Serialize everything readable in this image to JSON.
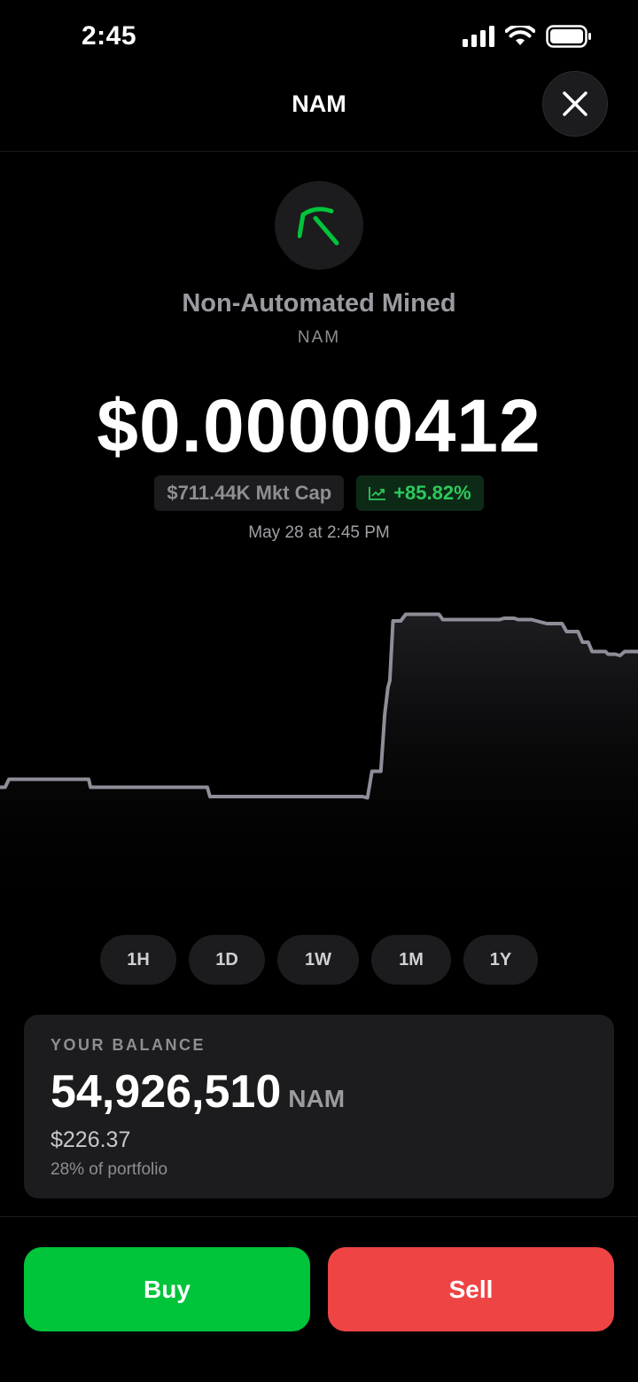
{
  "status_bar": {
    "time": "2:45"
  },
  "header": {
    "title": "NAM",
    "close_icon": "close-icon"
  },
  "token": {
    "icon": "pickaxe-icon",
    "icon_color": "#00c43a",
    "name": "Non-Automated Mined",
    "symbol": "NAM",
    "price": "$0.00000412",
    "market_cap": "$711.44K Mkt Cap",
    "change": "+85.82%",
    "change_icon": "trending-up-icon",
    "timestamp": "May 28 at 2:45 PM"
  },
  "chart_data": {
    "type": "line",
    "ylim": [
      0,
      1
    ],
    "grid": false,
    "line_color": "#8e8e98",
    "points": [
      [
        0,
        0.325
      ],
      [
        0.8,
        0.325
      ],
      [
        1.4,
        0.355
      ],
      [
        2.8,
        0.355
      ],
      [
        13.9,
        0.355
      ],
      [
        14.2,
        0.325
      ],
      [
        32.5,
        0.325
      ],
      [
        32.9,
        0.29
      ],
      [
        56.8,
        0.29
      ],
      [
        57.6,
        0.285
      ],
      [
        58.3,
        0.385
      ],
      [
        59.7,
        0.385
      ],
      [
        60.3,
        0.6
      ],
      [
        60.8,
        0.7
      ],
      [
        61.1,
        0.725
      ],
      [
        61.6,
        0.95
      ],
      [
        62.8,
        0.95
      ],
      [
        63.6,
        0.975
      ],
      [
        68.8,
        0.975
      ],
      [
        69.4,
        0.955
      ],
      [
        78.3,
        0.955
      ],
      [
        79.0,
        0.96
      ],
      [
        80.6,
        0.96
      ],
      [
        81.2,
        0.955
      ],
      [
        83.3,
        0.955
      ],
      [
        85.7,
        0.94
      ],
      [
        88.1,
        0.94
      ],
      [
        88.8,
        0.91
      ],
      [
        90.6,
        0.91
      ],
      [
        91.3,
        0.87
      ],
      [
        92.2,
        0.87
      ],
      [
        92.8,
        0.835
      ],
      [
        94.9,
        0.835
      ],
      [
        95.3,
        0.825
      ],
      [
        96.4,
        0.825
      ],
      [
        97.2,
        0.82
      ],
      [
        97.9,
        0.835
      ],
      [
        100,
        0.835
      ]
    ]
  },
  "ranges": [
    {
      "label": "1H",
      "active": false
    },
    {
      "label": "1D",
      "active": false
    },
    {
      "label": "1W",
      "active": true
    },
    {
      "label": "1M",
      "active": false
    },
    {
      "label": "1Y",
      "active": false
    }
  ],
  "balance": {
    "label": "YOUR BALANCE",
    "amount": "54,926,510",
    "unit": "NAM",
    "usd": "$226.37",
    "portfolio_pct": "28% of portfolio"
  },
  "actions": {
    "buy_label": "Buy",
    "sell_label": "Sell"
  },
  "colors": {
    "buy": "#00c43a",
    "sell": "#ef4444",
    "positive": "#2ec95c"
  }
}
